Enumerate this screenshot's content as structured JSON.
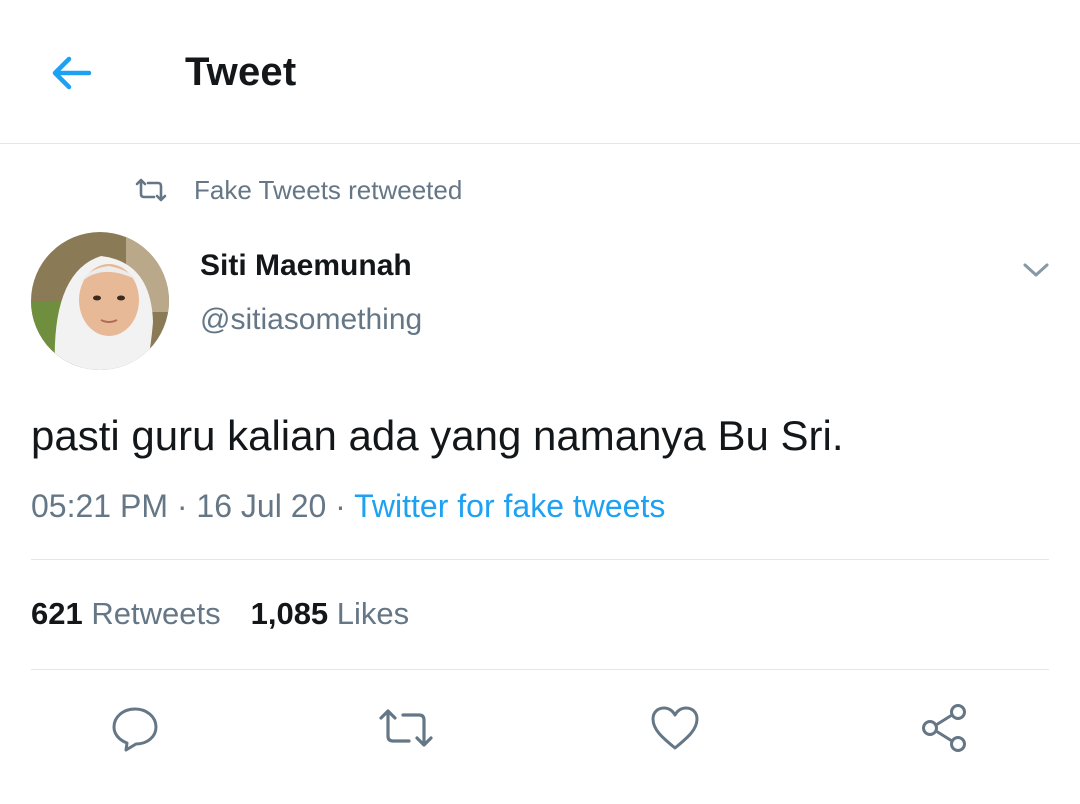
{
  "header": {
    "title": "Tweet",
    "back_icon": "arrow-left-icon",
    "accent": "#1da1f2"
  },
  "retweet_context": {
    "icon": "retweet-icon",
    "text": "Fake Tweets retweeted"
  },
  "tweet": {
    "author": {
      "display_name": "Siti Maemunah",
      "handle": "@sitiasomething",
      "avatar": "avatar-photo"
    },
    "more_icon": "chevron-down-icon",
    "text": "pasti guru kalian ada yang namanya Bu Sri.",
    "time": "05:21 PM",
    "separator": "·",
    "date": "16 Jul 20",
    "source": "Twitter for fake tweets"
  },
  "stats": {
    "retweets_count": "621",
    "retweets_label": "Retweets",
    "likes_count": "1,085",
    "likes_label": "Likes"
  },
  "actions": [
    {
      "icon": "reply-icon"
    },
    {
      "icon": "retweet-icon"
    },
    {
      "icon": "heart-icon"
    },
    {
      "icon": "share-icon"
    }
  ],
  "colors": {
    "primary_text": "#14171a",
    "secondary_text": "#657786",
    "link": "#1da1f2",
    "border": "#e1e8ed"
  }
}
